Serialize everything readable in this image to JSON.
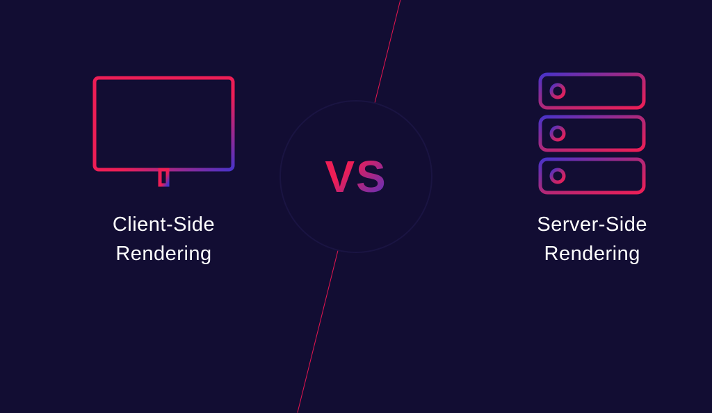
{
  "center": {
    "vs_label": "VS"
  },
  "left": {
    "title": "Client-Side\nRendering"
  },
  "right": {
    "title": "Server-Side\nRendering"
  },
  "colors": {
    "background": "#120d33",
    "gradient_start": "#ed1e56",
    "gradient_end": "#4833c9",
    "text": "#ffffff"
  }
}
